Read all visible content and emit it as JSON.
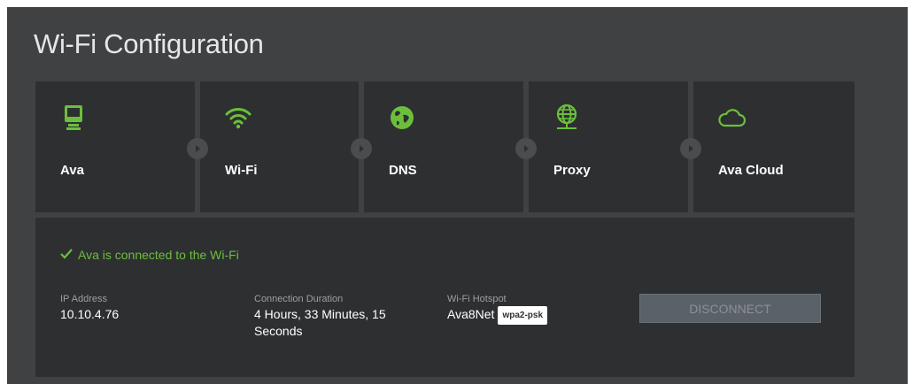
{
  "page": {
    "title": "Wi-Fi Configuration"
  },
  "steps": [
    {
      "label": "Ava",
      "icon": "device-icon"
    },
    {
      "label": "Wi-Fi",
      "icon": "wifi-icon"
    },
    {
      "label": "DNS",
      "icon": "globe-icon"
    },
    {
      "label": "Proxy",
      "icon": "network-globe-icon"
    },
    {
      "label": "Ava Cloud",
      "icon": "cloud-icon"
    }
  ],
  "status": {
    "message": "Ava is connected to the Wi-Fi",
    "ip_label": "IP Address",
    "ip_value": "10.10.4.76",
    "duration_label": "Connection Duration",
    "duration_value": "4 Hours, 33 Minutes, 15 Seconds",
    "hotspot_label": "Wi-Fi Hotspot",
    "hotspot_value": "Ava8Net",
    "security_badge": "wpa2-psk",
    "disconnect_label": "DISCONNECT"
  },
  "colors": {
    "accent": "#6cbf3d",
    "panel": "#3f4143",
    "card": "#2d2f31"
  }
}
